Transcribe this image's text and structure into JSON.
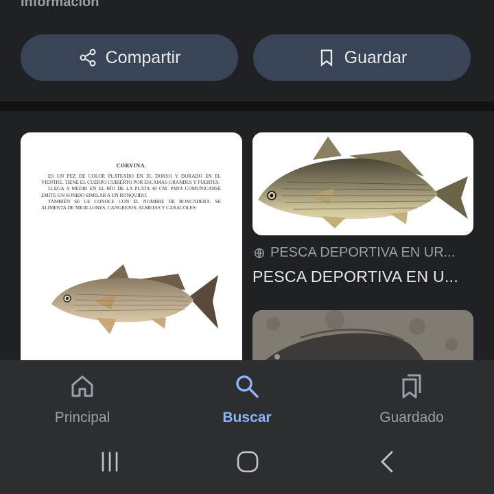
{
  "header": {
    "info_title": "Información",
    "share_label": "Compartir",
    "save_label": "Guardar"
  },
  "results": {
    "left_card": {
      "doc_title": "CORVINA.",
      "doc_paragraphs": [
        "Es un pez de color plateado en el dorso y dorado en el vientre. Tiene el cuerpo cubierto por escamas grandes y fuertes.",
        "Llega a medir en el Río de la Plata 40 cm. Para comunicarse emite un sonido similar a un ronquido.",
        "También se le conoce con el nombre de roncadera. Se alimenta de mejillones, cangrejos, almejas y caracoles."
      ]
    },
    "right_card": {
      "source": "PESCA DEPORTIVA EN UR...",
      "title": "PESCA DEPORTIVA EN U..."
    }
  },
  "bottom_nav": {
    "items": [
      {
        "label": "Principal",
        "icon": "home-icon"
      },
      {
        "label": "Buscar",
        "icon": "search-icon",
        "active": true
      },
      {
        "label": "Guardado",
        "icon": "saved-collections-icon"
      }
    ]
  },
  "colors": {
    "background": "#202124",
    "pill": "#394457",
    "accent": "#8ab4f8",
    "nav_bg": "#2d2e31",
    "muted_text": "#9aa0a6"
  }
}
